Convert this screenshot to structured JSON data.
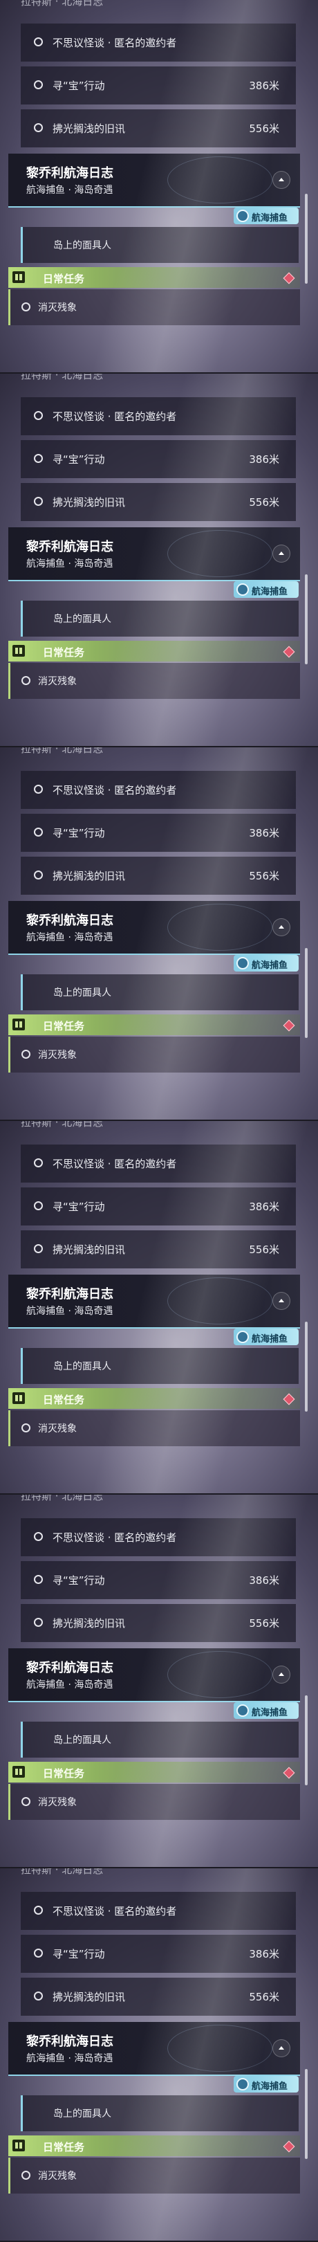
{
  "top_title": "拉特斯 · 北海日志",
  "quests": [
    {
      "label": "不思议怪谈 · 匿名的邀约者",
      "distance": ""
    },
    {
      "label": "寻“宝”行动",
      "distance": "386米"
    },
    {
      "label": "拂光搁浅的旧讯",
      "distance": "556米"
    }
  ],
  "log_card": {
    "title": "黎乔利航海日志",
    "subtitle": "航海捕鱼 · 海岛奇遇",
    "badge": "航海捕鱼"
  },
  "sub_quest": "岛上的面具人",
  "daily": {
    "title": "日常任务",
    "task": "消灭残象"
  },
  "colors": {
    "accent_cyan": "#8fd4e8",
    "daily_green": "#b9dd7c",
    "gem_red": "#e0566b"
  }
}
